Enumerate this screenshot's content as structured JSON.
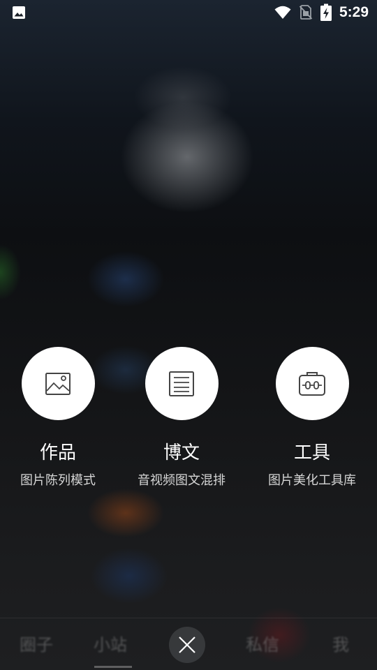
{
  "status_bar": {
    "time": "5:29",
    "icons": [
      "gallery-icon",
      "wifi-icon",
      "no-sim-icon",
      "battery-charging-icon"
    ]
  },
  "actions": [
    {
      "icon": "image-icon",
      "title": "作品",
      "subtitle": "图片陈列模式"
    },
    {
      "icon": "article-icon",
      "title": "博文",
      "subtitle": "音视频图文混排"
    },
    {
      "icon": "toolbox-icon",
      "title": "工具",
      "subtitle": "图片美化工具库"
    }
  ],
  "bottom_nav": {
    "items": [
      "圈子",
      "小站",
      "私信",
      "我"
    ],
    "active_index": 1,
    "close_icon": "close-icon"
  }
}
